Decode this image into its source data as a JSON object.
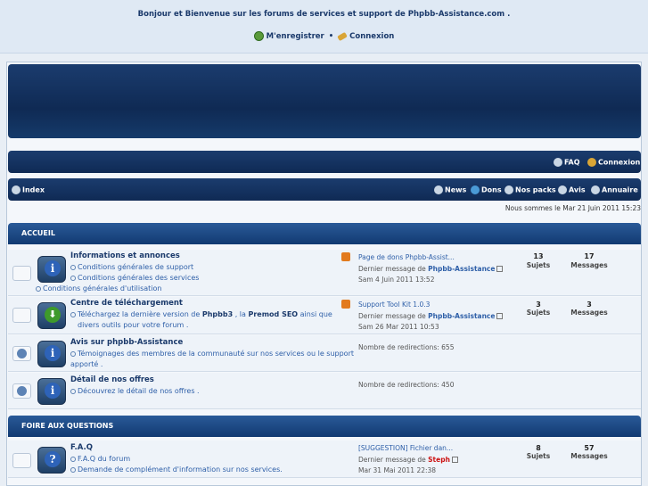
{
  "header": {
    "welcome": "Bonjour et Bienvenue sur les forums de services et support de Phpbb-Assistance.com .",
    "register": "M'enregistrer",
    "separator": "•",
    "login": "Connexion"
  },
  "nav1": {
    "faq": "FAQ",
    "login": "Connexion"
  },
  "nav2": {
    "index": "Index",
    "news": "News",
    "dons": "Dons",
    "packs": "Nos packs",
    "avis": "Avis",
    "annuaire": "Annuaire"
  },
  "date": "Nous sommes le Mar 21 Juin 2011 15:23",
  "categories": [
    {
      "title": "ACCUEIL"
    },
    {
      "title": "FOIRE AUX QUESTIONS"
    }
  ],
  "forums": [
    {
      "title": "Informations et annonces",
      "desc1": "Conditions générales de support",
      "desc2": "Conditions générales des services",
      "desc3": "Conditions générales d'utilisation",
      "last_title": "Page de dons Phpbb-Assist...",
      "last_label": "Dernier message de",
      "last_author": "Phpbb-Assistance",
      "last_date": "Sam 4 Juin 2011 13:52",
      "topics": "13",
      "posts": "17"
    },
    {
      "title": "Centre de téléchargement",
      "desc1a": "Téléchargez la dernière version de",
      "desc1b": "Phpbb3",
      "desc1c": ", la",
      "desc1d": "Premod SEO",
      "desc1e": "ainsi que",
      "desc2": "divers outils pour votre forum .",
      "last_title": "Support Tool Kit 1.0.3",
      "last_label": "Dernier message de",
      "last_author": "Phpbb-Assistance",
      "last_date": "Sam 26 Mar 2011 10:53",
      "topics": "3",
      "posts": "3"
    },
    {
      "title": "Avis sur phpbb-Assistance",
      "desc1": "Témoignages des membres de la communauté sur nos services ou le support",
      "desc2": "apporté .",
      "redirects": "Nombre de redirections: 655"
    },
    {
      "title": "Détail de nos offres",
      "desc1": "Découvrez le détail de nos offres .",
      "redirects": "Nombre de redirections: 450"
    },
    {
      "title": "F.A.Q",
      "desc1": "F.A.Q du forum",
      "desc2": "Demande de complément d'information sur nos services.",
      "last_title": "[SUGGESTION] Fichier dan...",
      "last_label": "Dernier message de",
      "last_author": "Steph",
      "last_date": "Mar 31 Mai 2011 22:38",
      "topics": "8",
      "posts": "57"
    }
  ],
  "labels": {
    "topics": "Sujets",
    "posts": "Messages"
  },
  "colors": {
    "accent": "#1b3a6b",
    "link": "#2e5fa8",
    "bar": "#0f2a54",
    "author_red": "#cc1111"
  }
}
